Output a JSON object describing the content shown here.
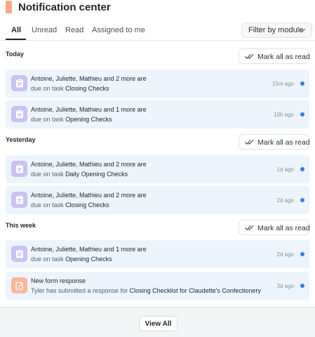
{
  "header": {
    "title": "Notification center"
  },
  "tabs": [
    {
      "label": "All",
      "active": true
    },
    {
      "label": "Unread",
      "active": false
    },
    {
      "label": "Read",
      "active": false
    },
    {
      "label": "Assigned to me",
      "active": false
    }
  ],
  "filter": {
    "label": "Filter by module",
    "icon": "chevron-down-icon"
  },
  "mark_all_label": "Mark all as read",
  "sections": [
    {
      "label": "Today",
      "items": [
        {
          "icon": "task-clipboard-icon",
          "title": "Antoine, Juliette, Mathieu and 2 more are",
          "prefix": "due on task",
          "subject": "Closing Checks",
          "time": "15m ago",
          "unread": true
        },
        {
          "icon": "task-clipboard-icon",
          "title": "Antoine, Juliette, Mathieu and 1 more are",
          "prefix": "due on task",
          "subject": "Opening Checks",
          "time": "10h ago",
          "unread": true
        }
      ]
    },
    {
      "label": "Yesterday",
      "items": [
        {
          "icon": "task-clipboard-icon",
          "title": "Antoine, Juliette, Mathieu and 2 more are",
          "prefix": "due on task",
          "subject": "Daily Opening Checks",
          "time": "1d ago",
          "unread": true
        },
        {
          "icon": "task-clipboard-icon",
          "title": "Antoine, Juliette, Mathieu and 2 more are",
          "prefix": "due on task",
          "subject": "Closing Checks",
          "time": "2d ago",
          "unread": true
        }
      ]
    },
    {
      "label": "This week",
      "items": [
        {
          "icon": "task-clipboard-icon",
          "title": "Antoine, Juliette, Mathieu and 1 more are",
          "prefix": "due on task",
          "subject": "Opening Checks",
          "time": "2d ago",
          "unread": true
        },
        {
          "icon": "form-edit-icon",
          "title": "New form response",
          "prefix": "Tyler has submitted a response for",
          "subject": "Closing Checklist for Claudette's Confectionery",
          "time": "3d ago",
          "unread": true
        }
      ]
    }
  ],
  "footer": {
    "view_all_label": "View All"
  },
  "colors": {
    "accent_dot": "#2f7ee4",
    "card_bg": "#edf4fb",
    "task_icon_bg": "#c9c2f2",
    "form_icon_bg": "#f9b79c",
    "brand": "#f7a98a"
  }
}
